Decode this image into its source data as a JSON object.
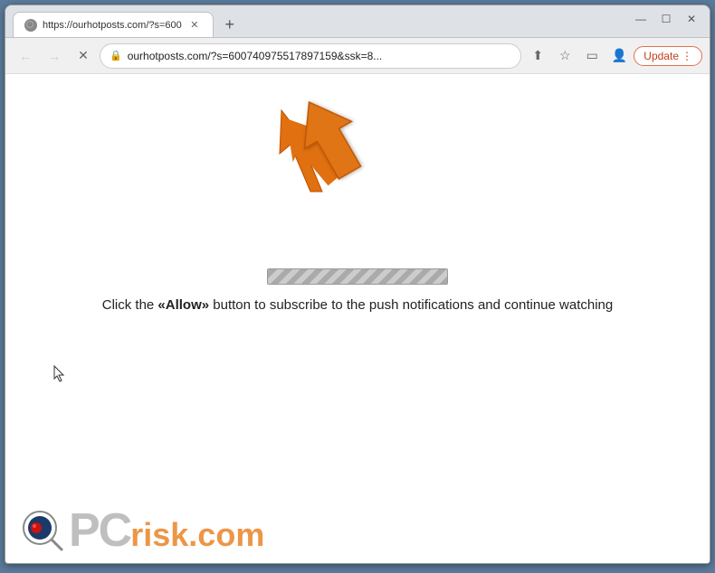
{
  "browser": {
    "tab": {
      "title": "https://ourhotposts.com/?s=600",
      "favicon_label": "tab-favicon"
    },
    "new_tab_label": "+",
    "window_controls": {
      "minimize": "—",
      "maximize": "☐",
      "close": "✕"
    },
    "nav": {
      "back_label": "←",
      "forward_label": "→",
      "reload_label": "✕",
      "url": "ourhotposts.com/?s=600740975517897159&ssk=8...",
      "lock_icon": "🔒",
      "share_icon": "⬆",
      "bookmark_icon": "☆",
      "split_icon": "▭",
      "profile_icon": "👤",
      "update_label": "Update",
      "more_label": "⋮"
    }
  },
  "page": {
    "instruction_text": "Click the «Allow» button to subscribe to the push notifications and continue watching",
    "instruction_parts": {
      "before": "Click the ",
      "allow": "«Allow»",
      "after": " button to subscribe to the push notifications and continue watching"
    },
    "progress_bar_aria": "Loading progress bar"
  },
  "watermark": {
    "pc_text": "PC",
    "risk_text": "risk.com"
  },
  "arrow": {
    "color": "#e07010",
    "direction": "up-left"
  }
}
